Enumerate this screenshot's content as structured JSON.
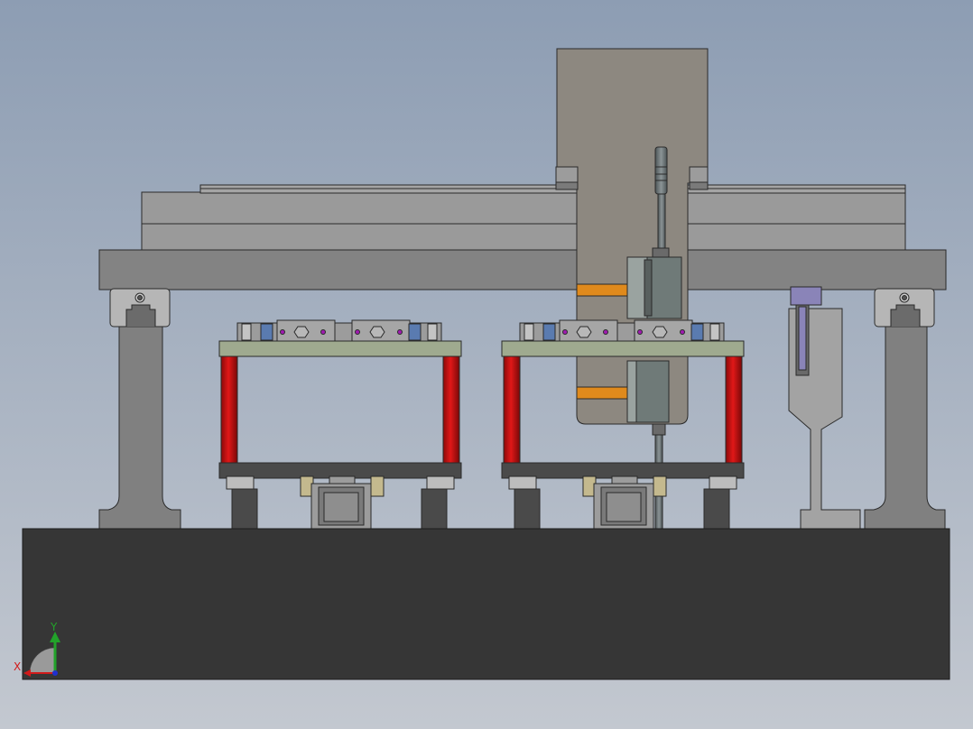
{
  "viewport": {
    "background_top": "#8d9db3",
    "background_bottom": "#c3c8d0"
  },
  "colors": {
    "base": "#363636",
    "frame_gray": "#838383",
    "column_gray": "#9c9c9c",
    "carriage_gray": "#8d8880",
    "plate_green": "#9faa8f",
    "red_column": "#cc1010",
    "orange_block": "#e08a1c",
    "blue_clamp": "#5a7bb0",
    "purple_block": "#8a84b8",
    "motor_gray": "#707a78"
  },
  "triad": {
    "x_label": "X",
    "y_label": "Y",
    "x_color": "#d11a1a",
    "y_color": "#22a22a",
    "z_color": "#2030d0"
  }
}
